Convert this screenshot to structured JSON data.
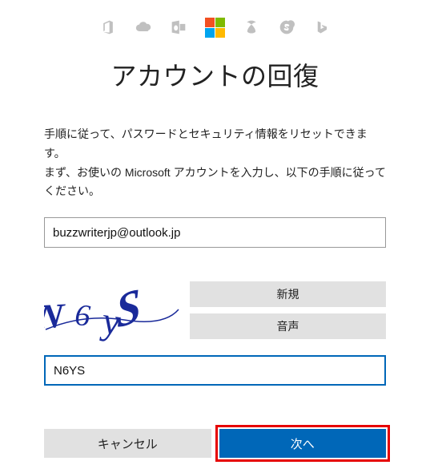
{
  "header": {
    "icons": [
      "office-icon",
      "onedrive-icon",
      "outlook-icon",
      "microsoft-logo",
      "xbox-icon",
      "skype-icon",
      "bing-icon"
    ]
  },
  "title": "アカウントの回復",
  "instructions_line1": "手順に従って、パスワードとセキュリティ情報をリセットできます。",
  "instructions_line2": "まず、お使いの Microsoft アカウントを入力し、以下の手順に従ってください。",
  "account_field": {
    "value": "buzzwriterjp@outlook.jp"
  },
  "captcha": {
    "displayed_text": "N6YS",
    "new_label": "新規",
    "audio_label": "音声"
  },
  "captcha_field": {
    "value": "N6YS"
  },
  "buttons": {
    "cancel": "キャンセル",
    "next": "次へ"
  },
  "colors": {
    "primary": "#0067b8",
    "highlight": "#e60000"
  }
}
